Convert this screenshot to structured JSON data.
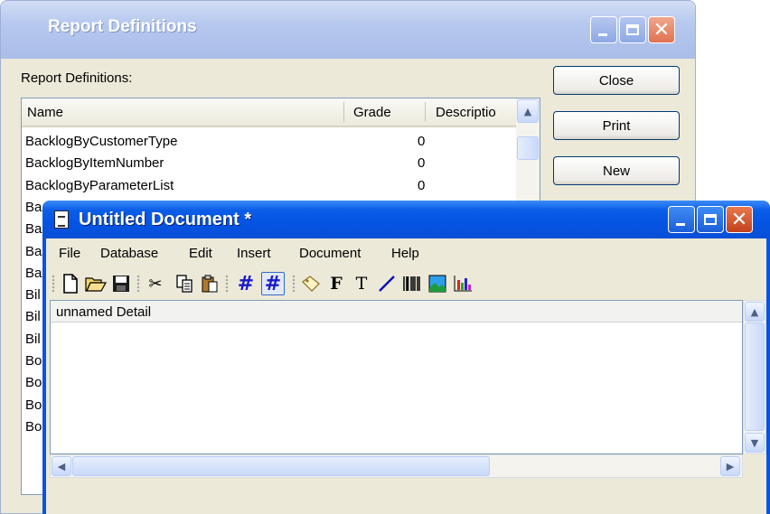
{
  "report_window": {
    "title": "Report Definitions",
    "list_label": "Report Definitions:",
    "columns": [
      "Name",
      "Grade",
      "Descriptio"
    ],
    "rows": [
      {
        "name": "BacklogByCustomerType",
        "grade": "0"
      },
      {
        "name": "BacklogByItemNumber",
        "grade": "0"
      },
      {
        "name": "BacklogByParameterList",
        "grade": "0"
      },
      {
        "name": "Ba",
        "grade": ""
      },
      {
        "name": "Ba",
        "grade": ""
      },
      {
        "name": "Ba",
        "grade": ""
      },
      {
        "name": "Ba",
        "grade": ""
      },
      {
        "name": "Bil",
        "grade": ""
      },
      {
        "name": "Bil",
        "grade": ""
      },
      {
        "name": "Bil",
        "grade": ""
      },
      {
        "name": "Bo",
        "grade": ""
      },
      {
        "name": "Bo",
        "grade": ""
      },
      {
        "name": "Bo",
        "grade": ""
      },
      {
        "name": "Bo",
        "grade": ""
      }
    ],
    "buttons": {
      "close": "Close",
      "print": "Print",
      "new": "New"
    }
  },
  "document_window": {
    "title": "Untitled Document *",
    "menu": [
      "File",
      "Database",
      "Edit",
      "Insert",
      "Document",
      "Help"
    ],
    "toolbar_icons": [
      "new-icon",
      "open-icon",
      "save-icon",
      "cut-icon",
      "copy-icon",
      "paste-icon",
      "grid-icon",
      "snap-grid-icon",
      "label-icon",
      "bold-field-icon",
      "text-icon",
      "line-icon",
      "barcode-icon",
      "image-icon",
      "chart-icon"
    ],
    "band_label": "unnamed Detail"
  },
  "colors": {
    "active_title": "#0a53e0",
    "inactive_title": "#b6c8ee",
    "face": "#ece9d8"
  }
}
